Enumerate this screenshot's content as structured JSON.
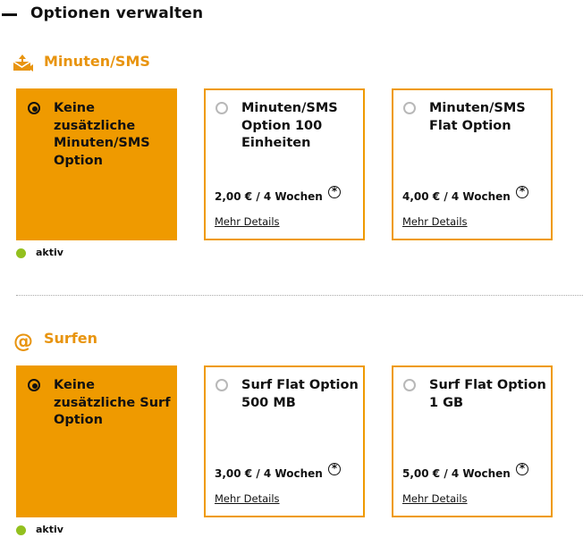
{
  "header": {
    "title": "Optionen verwalten"
  },
  "sections": [
    {
      "title": "Minuten/SMS",
      "icon": "sms-envelope-icon",
      "cards": [
        {
          "title": "Keine zusätzliche Minuten/SMS Option",
          "selected": true,
          "price": "",
          "details": ""
        },
        {
          "title": "Minuten/SMS Option 100 Einheiten",
          "selected": false,
          "price": "2,00 € / 4 Wochen",
          "details": "Mehr Details"
        },
        {
          "title": "Minuten/SMS Flat Option",
          "selected": false,
          "price": "4,00 € / 4 Wochen",
          "details": "Mehr Details"
        }
      ],
      "status": "aktiv"
    },
    {
      "title": "Surfen",
      "icon": "at-sign-icon",
      "cards": [
        {
          "title": "Keine zusätzliche Surf Option",
          "selected": true,
          "price": "",
          "details": ""
        },
        {
          "title": "Surf Flat Option 500 MB",
          "selected": false,
          "price": "3,00 € / 4 Wochen",
          "details": "Mehr Details"
        },
        {
          "title": "Surf Flat Option 1 GB",
          "selected": false,
          "price": "5,00 € / 4 Wochen",
          "details": "Mehr Details"
        }
      ],
      "status": "aktiv"
    }
  ],
  "footnote_symbol": "*",
  "colors": {
    "accent": "#ef9a00",
    "heading": "#e8940f",
    "status_dot": "#93c01f"
  }
}
